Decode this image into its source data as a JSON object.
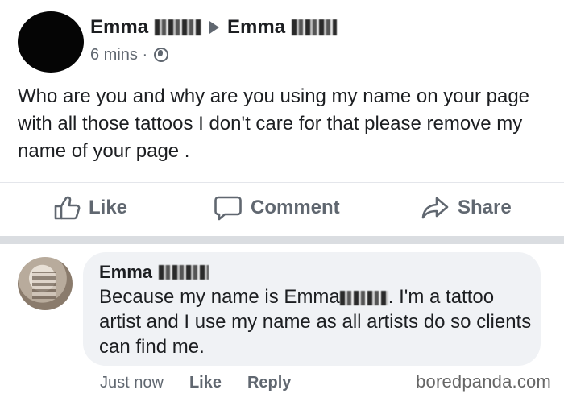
{
  "post": {
    "author_name": "Emma",
    "target_name": "Emma",
    "timestamp": "6 mins ·",
    "text": "Who are you and why are you using my name on your page with all those tattoos I don't care for that please remove my name of your page ."
  },
  "actions": {
    "like": "Like",
    "comment": "Comment",
    "share": "Share"
  },
  "comment": {
    "author_name": "Emma",
    "text_part1": "Because my name is Emma",
    "text_part2": ". I'm a tattoo artist and I use my name as all artists do so clients can find me.",
    "time": "Just now",
    "like_label": "Like",
    "reply_label": "Reply"
  },
  "watermark": "boredpanda.com",
  "icons": {
    "arrow": "right-triangle-icon",
    "audience": "globe-icon",
    "like": "thumbs-up-icon",
    "comment": "speech-bubble-icon",
    "share": "share-arrow-icon"
  }
}
